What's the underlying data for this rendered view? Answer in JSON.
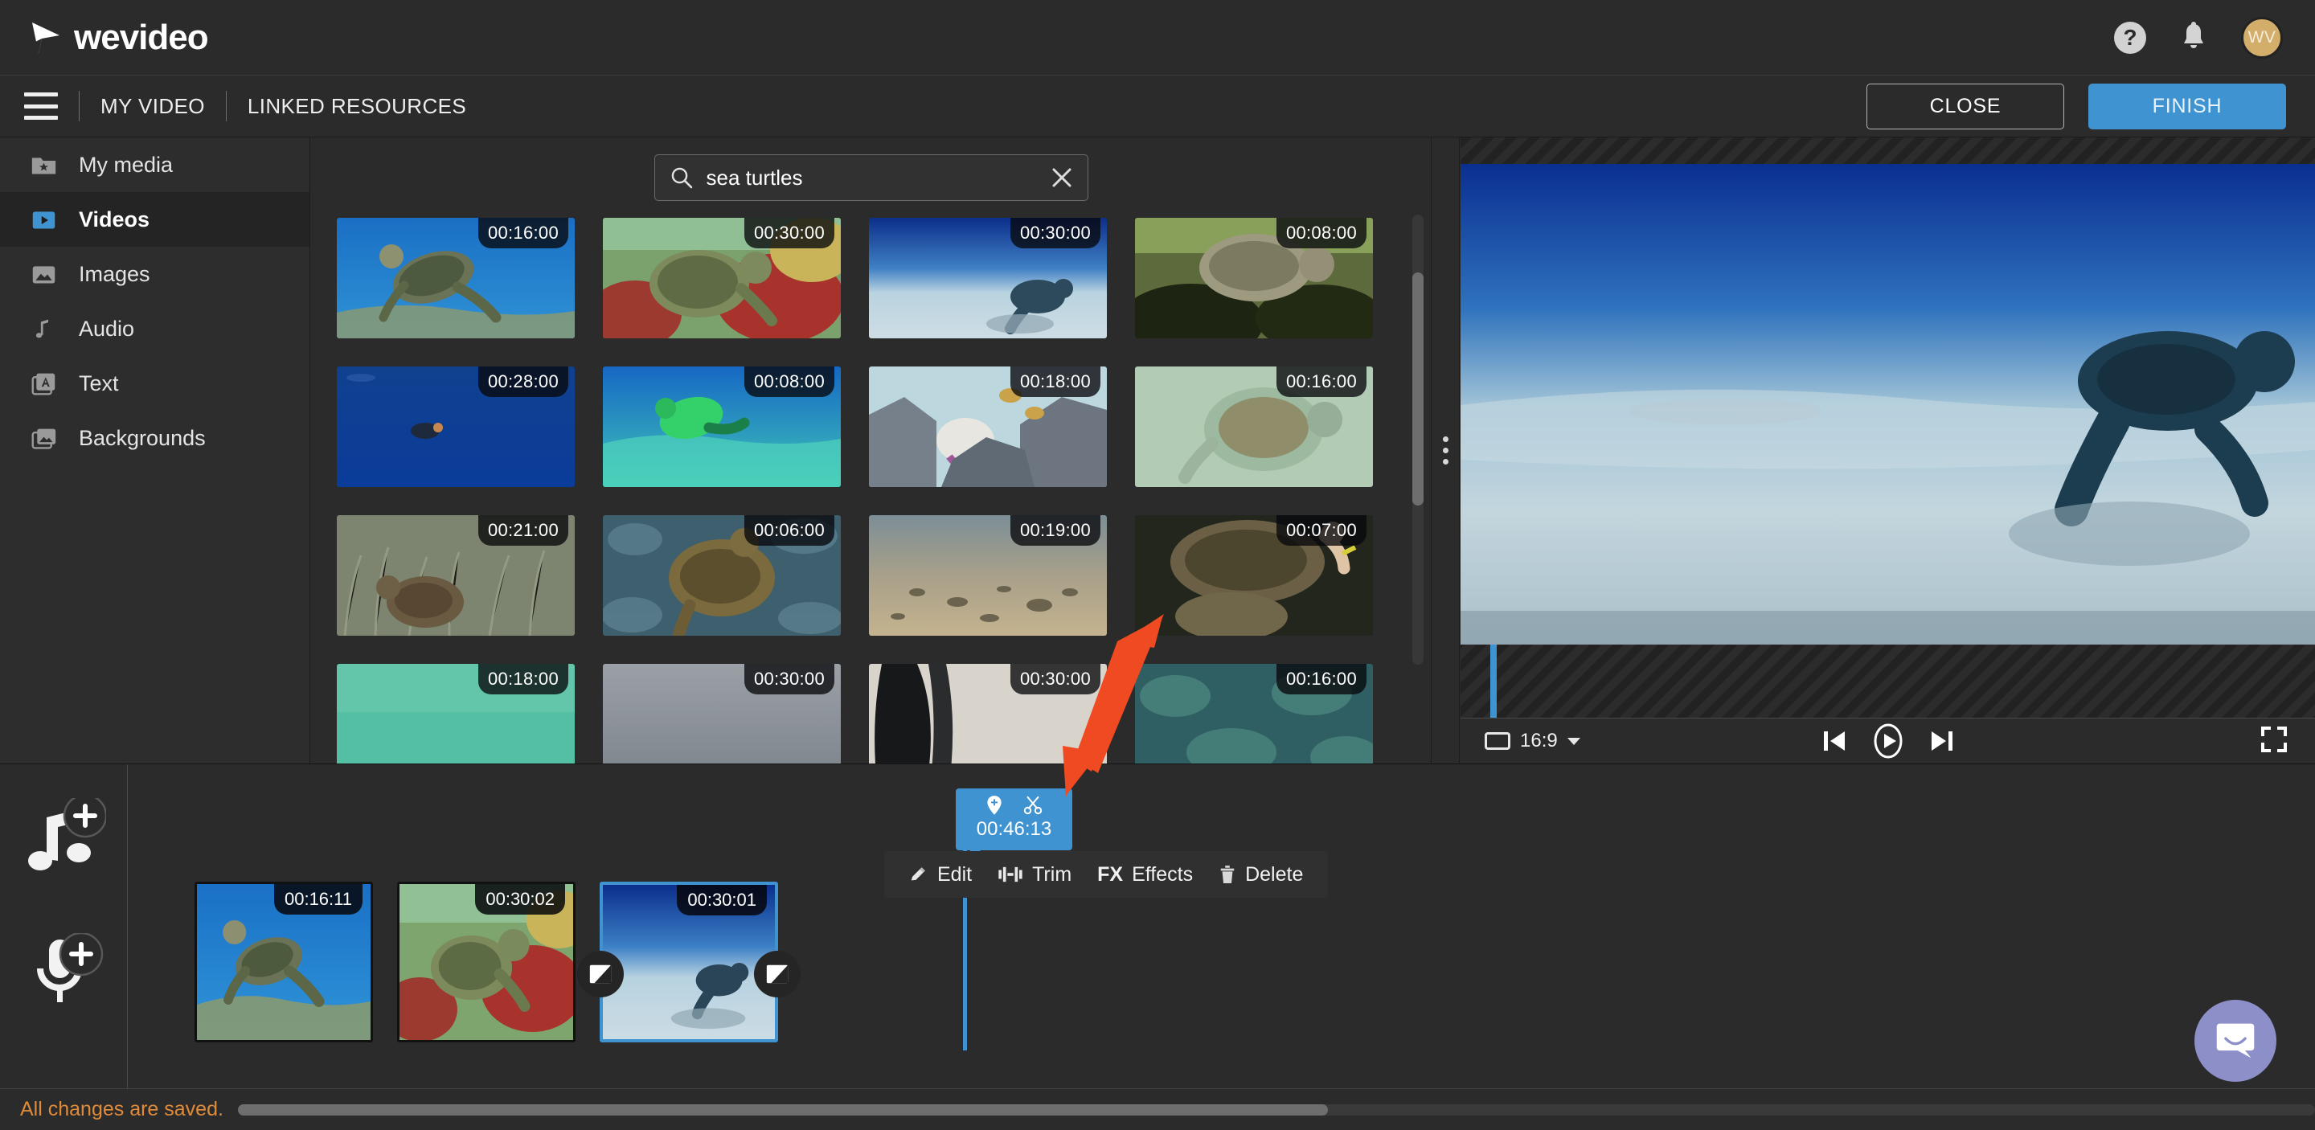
{
  "brand": {
    "name": "wevideo",
    "logo_icon": "play-triangle-logo",
    "help_icon": "help-circle-icon",
    "help_glyph": "?",
    "bell_icon": "notification-bell-icon",
    "avatar_initials": "WV",
    "avatar_color": "#d3ad6a"
  },
  "navbar": {
    "menu_icon": "hamburger-menu-icon",
    "items": [
      {
        "label": "MY VIDEO"
      },
      {
        "label": "LINKED RESOURCES"
      }
    ],
    "close_label": "CLOSE",
    "finish_label": "FINISH",
    "finish_color": "#3f93d1"
  },
  "sidebar": {
    "items": [
      {
        "label": "My media",
        "icon": "folder-star-icon",
        "active": false
      },
      {
        "label": "Videos",
        "icon": "video-play-icon",
        "active": true
      },
      {
        "label": "Images",
        "icon": "image-icon",
        "active": false
      },
      {
        "label": "Audio",
        "icon": "music-note-icon",
        "active": false
      },
      {
        "label": "Text",
        "icon": "text-a-icon",
        "active": false
      },
      {
        "label": "Backgrounds",
        "icon": "backgrounds-icon",
        "active": false
      }
    ]
  },
  "search": {
    "value": "sea turtles",
    "placeholder": "Search",
    "search_icon": "search-icon",
    "clear_icon": "close-x-icon"
  },
  "media_grid": {
    "items": [
      {
        "duration": "00:16:00",
        "scene": "turtle-swimming-blue-water"
      },
      {
        "duration": "00:30:00",
        "scene": "turtle-on-coral-reef"
      },
      {
        "duration": "00:30:00",
        "scene": "turtle-over-sandy-seabed"
      },
      {
        "duration": "00:08:00",
        "scene": "turtle-on-dark-reef"
      },
      {
        "duration": "00:28:00",
        "scene": "small-turtle-deep-blue"
      },
      {
        "duration": "00:08:00",
        "scene": "green-turtle-shallow-reef"
      },
      {
        "duration": "00:18:00",
        "scene": "rocky-reef-with-fish"
      },
      {
        "duration": "00:16:00",
        "scene": "pale-green-turtle"
      },
      {
        "duration": "00:21:00",
        "scene": "turtle-in-seagrass"
      },
      {
        "duration": "00:06:00",
        "scene": "turtle-on-textured-reef"
      },
      {
        "duration": "00:19:00",
        "scene": "turtle-on-sandy-bottom"
      },
      {
        "duration": "00:07:00",
        "scene": "hands-touching-turtle"
      },
      {
        "duration": "00:18:00",
        "scene": "teal-water-surface"
      },
      {
        "duration": "00:30:00",
        "scene": "grey-open-water"
      },
      {
        "duration": "00:30:00",
        "scene": "dark-silhouette"
      },
      {
        "duration": "00:16:00",
        "scene": "turtle-reef-texture"
      }
    ]
  },
  "preview": {
    "aspect_ratio": "16:9",
    "ratio_icon": "aspect-frame-icon",
    "caret_icon": "chevron-down-icon",
    "skip_back_icon": "skip-previous-icon",
    "play_icon": "play-circle-icon",
    "skip_forward_icon": "skip-next-icon",
    "fullscreen_icon": "fullscreen-icon",
    "scene": "turtle-swimming-over-sandy-seabed"
  },
  "timeline": {
    "add_music_icon": "add-music-note-icon",
    "add_voiceover_icon": "add-microphone-icon",
    "playhead": {
      "time": "00:46:13",
      "marker_icon": "location-marker-icon",
      "split_icon": "scissors-icon"
    },
    "context_menu": [
      {
        "label": "Edit",
        "icon": "pencil-icon"
      },
      {
        "label": "Trim",
        "icon": "trim-icon"
      },
      {
        "label": "Effects",
        "icon": "fx-icon",
        "prefix": "FX"
      },
      {
        "label": "Delete",
        "icon": "trash-icon"
      }
    ],
    "clips": [
      {
        "duration": "00:16:11",
        "scene": "turtle-swimming-blue-water",
        "selected": false
      },
      {
        "duration": "00:30:02",
        "scene": "turtle-on-coral-reef",
        "selected": false
      },
      {
        "duration": "00:30:01",
        "scene": "turtle-over-sandy-seabed",
        "selected": true
      }
    ],
    "transition_icon": "transition-icon"
  },
  "status": {
    "message": "All changes are saved."
  },
  "support": {
    "chat_icon": "intercom-chat-icon",
    "chat_color": "#8d8fc9"
  },
  "annotation": {
    "arrow_icon": "red-arrow-pointer",
    "arrow_color": "#ef4a21"
  }
}
